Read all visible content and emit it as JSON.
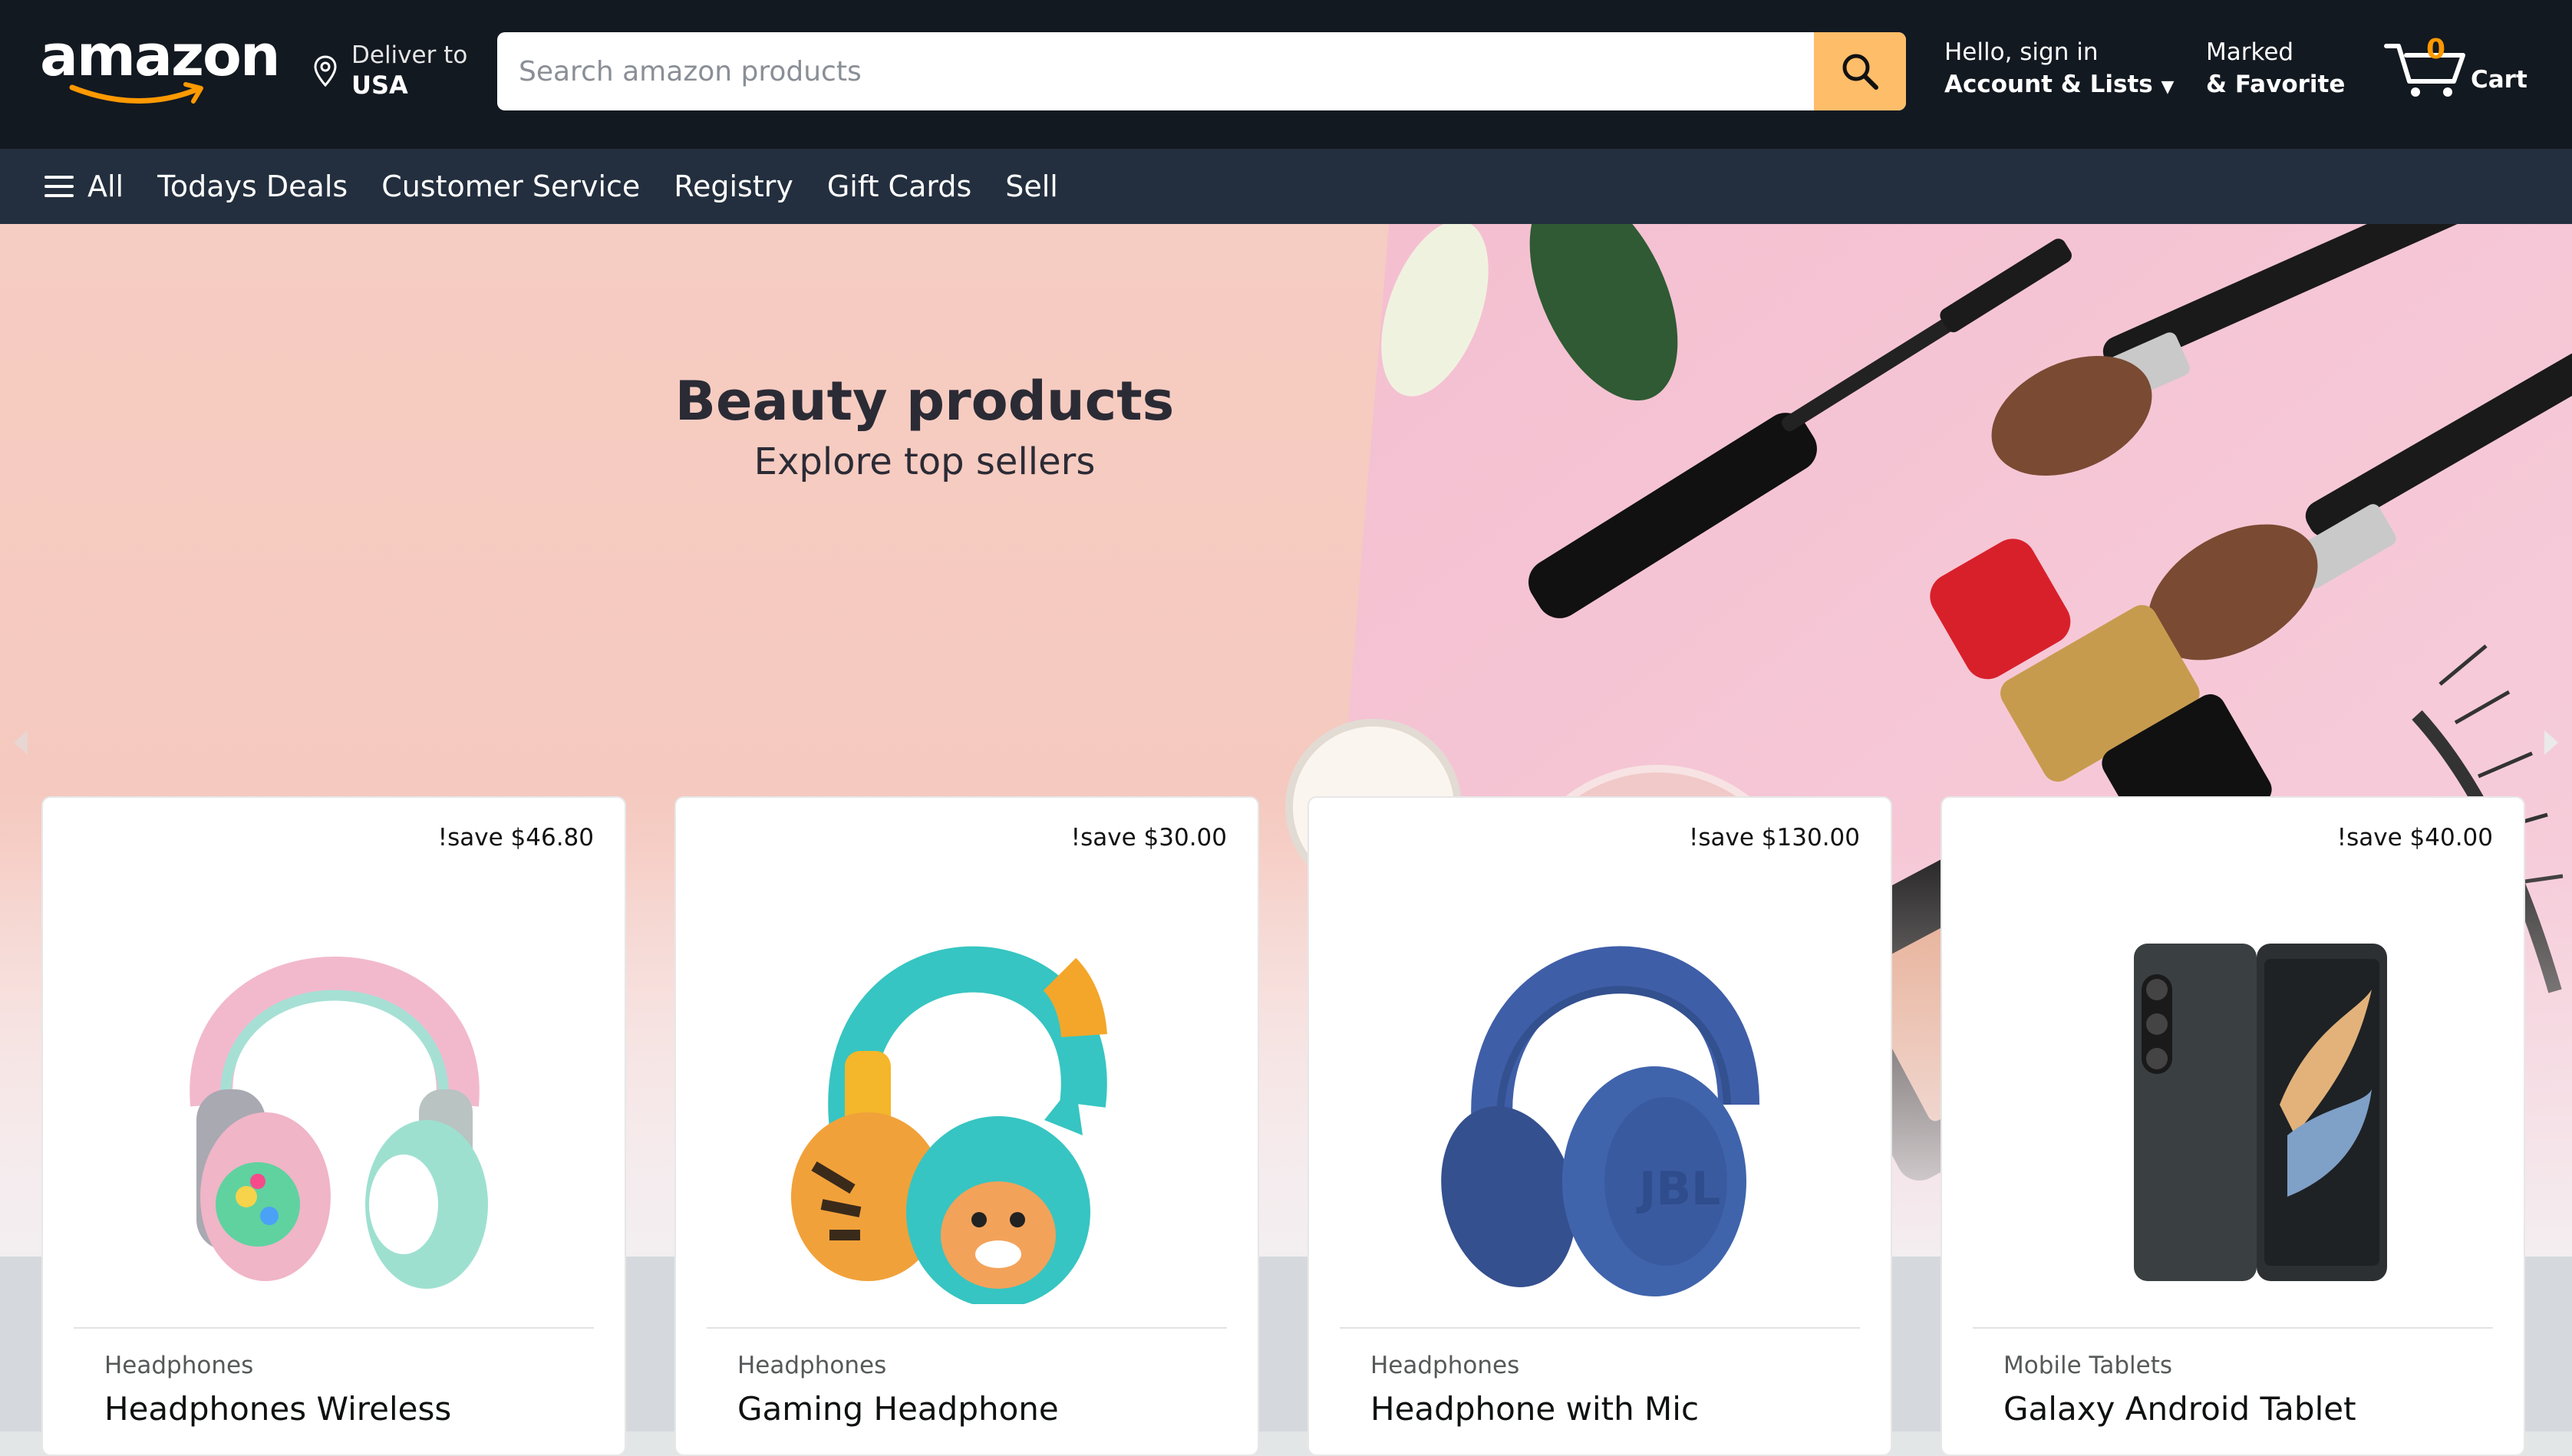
{
  "header": {
    "logo_text": "amazon",
    "deliver_line1": "Deliver to",
    "deliver_line2": "USA",
    "search_placeholder": "Search amazon products",
    "account_line1": "Hello, sign in",
    "account_line2": "Account & Lists",
    "marked_line1": "Marked",
    "marked_line2": "& Favorite",
    "cart_count": "0",
    "cart_label": "Cart"
  },
  "nav": {
    "all_label": "All",
    "items": [
      "Todays Deals",
      "Customer Service",
      "Registry",
      "Gift Cards",
      "Sell"
    ]
  },
  "hero": {
    "title": "Beauty products",
    "subtitle": "Explore top sellers"
  },
  "products": [
    {
      "save": "!save $46.80",
      "category": "Headphones",
      "name": "Headphones Wireless"
    },
    {
      "save": "!save $30.00",
      "category": "Headphones",
      "name": "Gaming Headphone"
    },
    {
      "save": "!save $130.00",
      "category": "Headphones",
      "name": "Headphone with Mic"
    },
    {
      "save": "!save $40.00",
      "category": "Mobile Tablets",
      "name": "Galaxy Android Tablet"
    }
  ],
  "colors": {
    "header_bg": "#131921",
    "nav_bg": "#232f3e",
    "search_button": "#febd69",
    "accent_orange": "#ff9900",
    "hero_bg": "#f6cdc2"
  }
}
